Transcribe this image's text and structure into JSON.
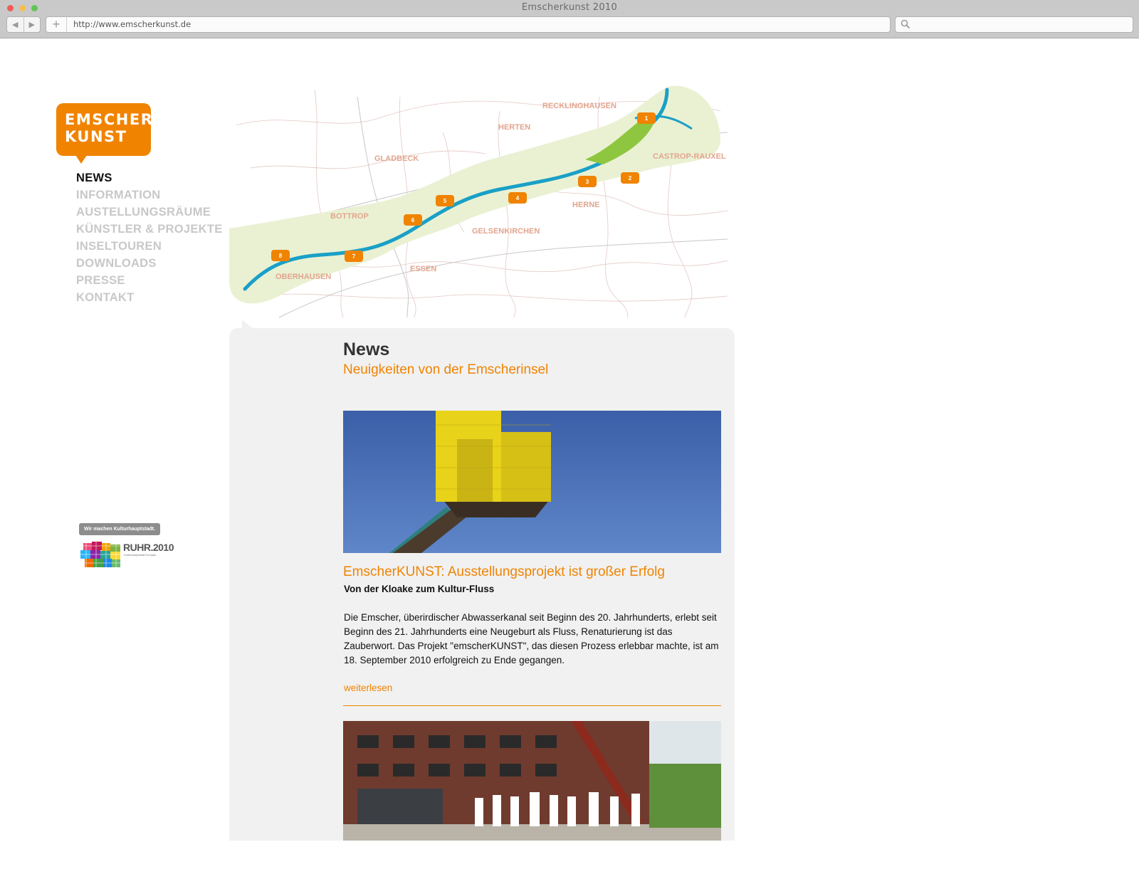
{
  "browser": {
    "window_title": "Emscherkunst 2010",
    "url": "http://www.emscherkunst.de"
  },
  "logo": {
    "line1": "EMSCHER",
    "line2": "KUNST",
    "color": "#f08300"
  },
  "nav": {
    "items": [
      {
        "label": "NEWS",
        "active": true
      },
      {
        "label": "INFORMATION"
      },
      {
        "label": "AUSTELLUNGSRÄUME"
      },
      {
        "label": "KÜNSTLER & PROJEKTE"
      },
      {
        "label": "INSELTOUREN"
      },
      {
        "label": "DOWNLOADS"
      },
      {
        "label": "PRESSE"
      },
      {
        "label": "KONTAKT"
      }
    ]
  },
  "sponsor": {
    "tag": "Wir machen Kulturhauptstadt.",
    "name": "RUHR.2010",
    "subtitle": "Kulturhauptstadt Europas"
  },
  "map": {
    "cities": [
      "RECKLINGHAUSEN",
      "HERTEN",
      "GLADBECK",
      "CASTROP-RAUXEL",
      "BOTTROP",
      "HERNE",
      "GELSENKIRCHEN",
      "OBERHAUSEN",
      "ESSEN"
    ],
    "markers": [
      "1",
      "2",
      "3",
      "4",
      "5",
      "6",
      "7",
      "8"
    ]
  },
  "news": {
    "heading": "News",
    "subheading": "Neuigkeiten von der Emscherinsel",
    "article": {
      "title": "EmscherKUNST: Ausstellungsprojekt ist großer Erfolg",
      "subtitle": "Von der Kloake zum Kultur-Fluss",
      "body": "Die Emscher, überirdischer Abwasserkanal seit Beginn des 20. Jahrhunderts, erlebt seit Beginn des 21. Jahrhunderts eine Neugeburt als Fluss, Renaturierung ist das Zauberwort. Das Projekt \"emscherKUNST\", das diesen Prozess erlebbar machte, ist am 18. September 2010 erfolgreich zu Ende gegangen.",
      "read_more": "weiterlesen"
    }
  },
  "colors": {
    "accent": "#f08300",
    "nav_inactive": "#c8c8c8",
    "panel": "#f1f1f1"
  }
}
